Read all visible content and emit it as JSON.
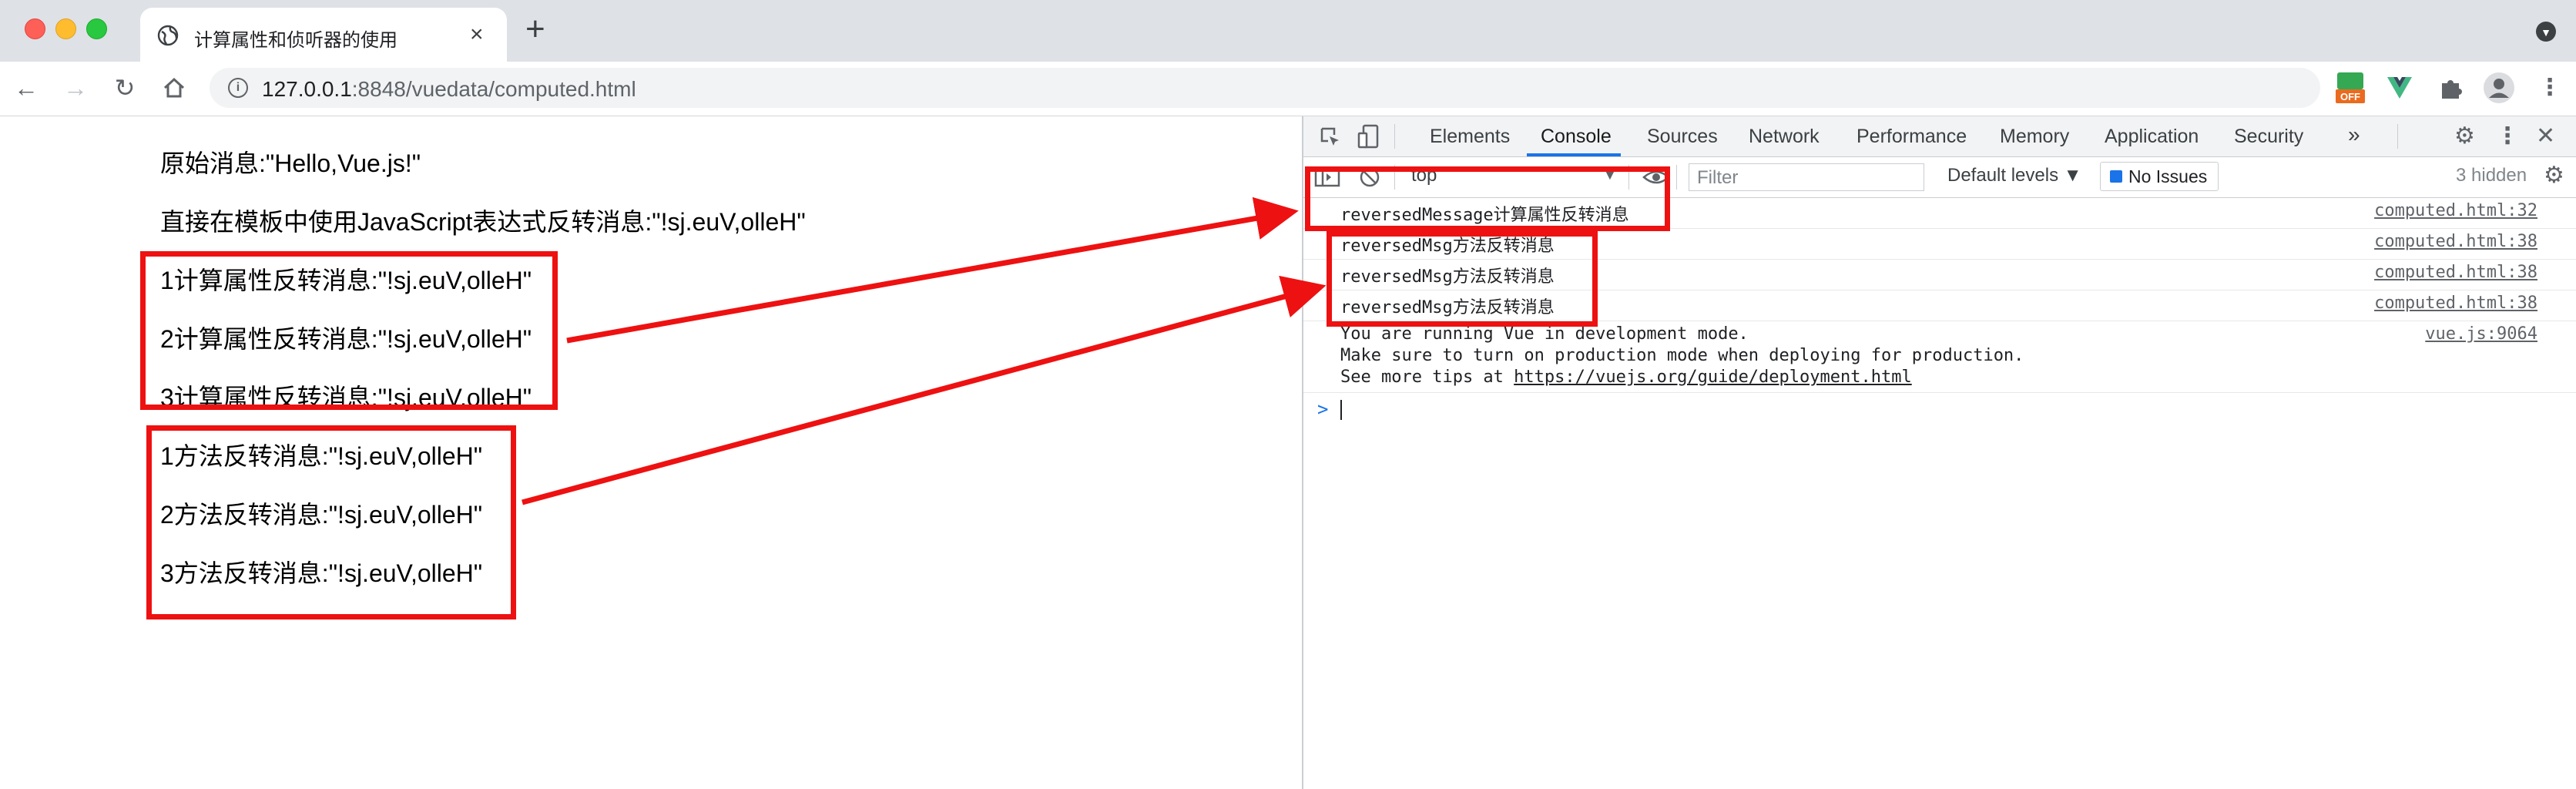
{
  "browser": {
    "tab_title": "计算属性和侦听器的使用",
    "url_host": "127.0.0.1",
    "url_rest": ":8848/vuedata/computed.html",
    "ext_badge": "OFF"
  },
  "page": {
    "lines": [
      "原始消息:\"Hello,Vue.js!\"",
      "直接在模板中使用JavaScript表达式反转消息:\"!sj.euV,olleH\"",
      "1计算属性反转消息:\"!sj.euV,olleH\"",
      "2计算属性反转消息:\"!sj.euV,olleH\"",
      "3计算属性反转消息:\"!sj.euV,olleH\"",
      "1方法反转消息:\"!sj.euV,olleH\"",
      "2方法反转消息:\"!sj.euV,olleH\"",
      "3方法反转消息:\"!sj.euV,olleH\""
    ]
  },
  "devtools": {
    "tabs": [
      "Elements",
      "Console",
      "Sources",
      "Network",
      "Performance",
      "Memory",
      "Application",
      "Security"
    ],
    "more": "»",
    "context": "top",
    "filter_placeholder": "Filter",
    "levels": "Default levels ▼",
    "issues": "No Issues",
    "hidden": "3 hidden",
    "console": [
      {
        "msg": "reversedMessage计算属性反转消息",
        "src": "computed.html:32"
      },
      {
        "msg": "reversedMsg方法反转消息",
        "src": "computed.html:38"
      },
      {
        "msg": "reversedMsg方法反转消息",
        "src": "computed.html:38"
      },
      {
        "msg": "reversedMsg方法反转消息",
        "src": "computed.html:38"
      }
    ],
    "vue_warning": {
      "line1": "You are running Vue in development mode.",
      "line2": "Make sure to turn on production mode when deploying for production.",
      "line3_prefix": "See more tips at ",
      "line3_link": "https://vuejs.org/guide/deployment.html",
      "src": "vue.js:9064"
    },
    "prompt": ">"
  },
  "colors": {
    "annotation_red": "#ee1111",
    "accent_blue": "#1a73e8"
  }
}
